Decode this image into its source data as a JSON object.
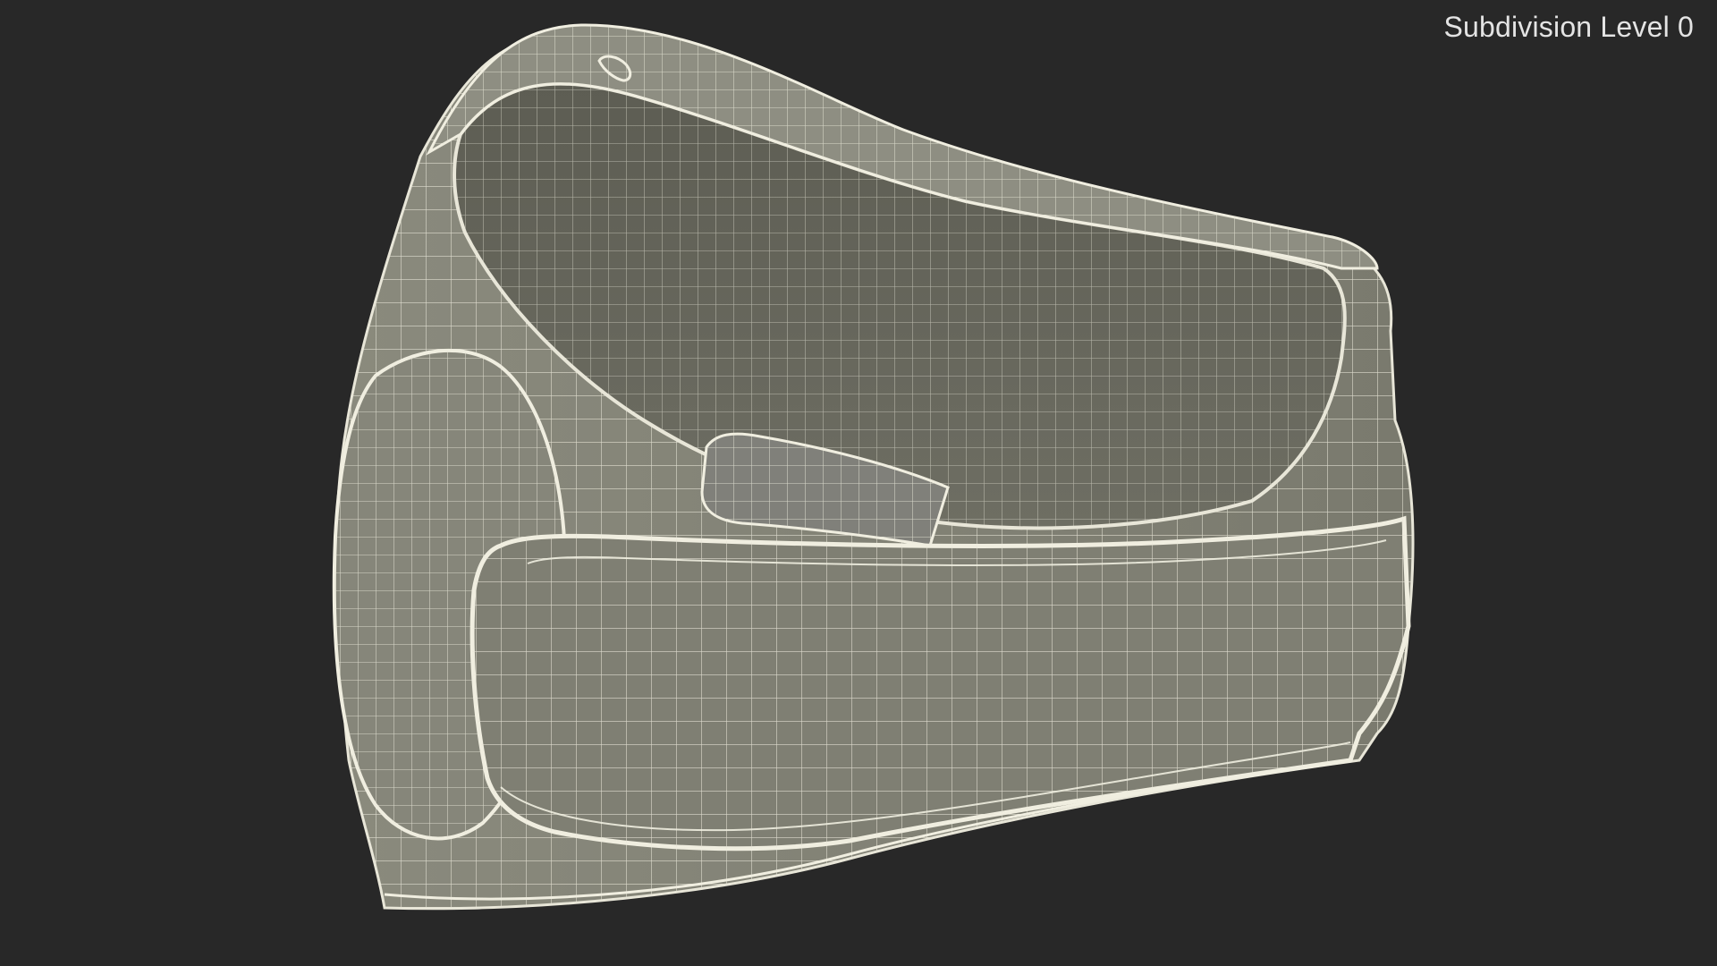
{
  "viewport": {
    "overlay_label": "Subdivision Level 0",
    "background_color": "#282828",
    "mesh_fill_color": "#7c7c70",
    "wire_color": "#e8e6d8"
  },
  "model": {
    "subject": "back-support-belt-wireframe-icon"
  }
}
